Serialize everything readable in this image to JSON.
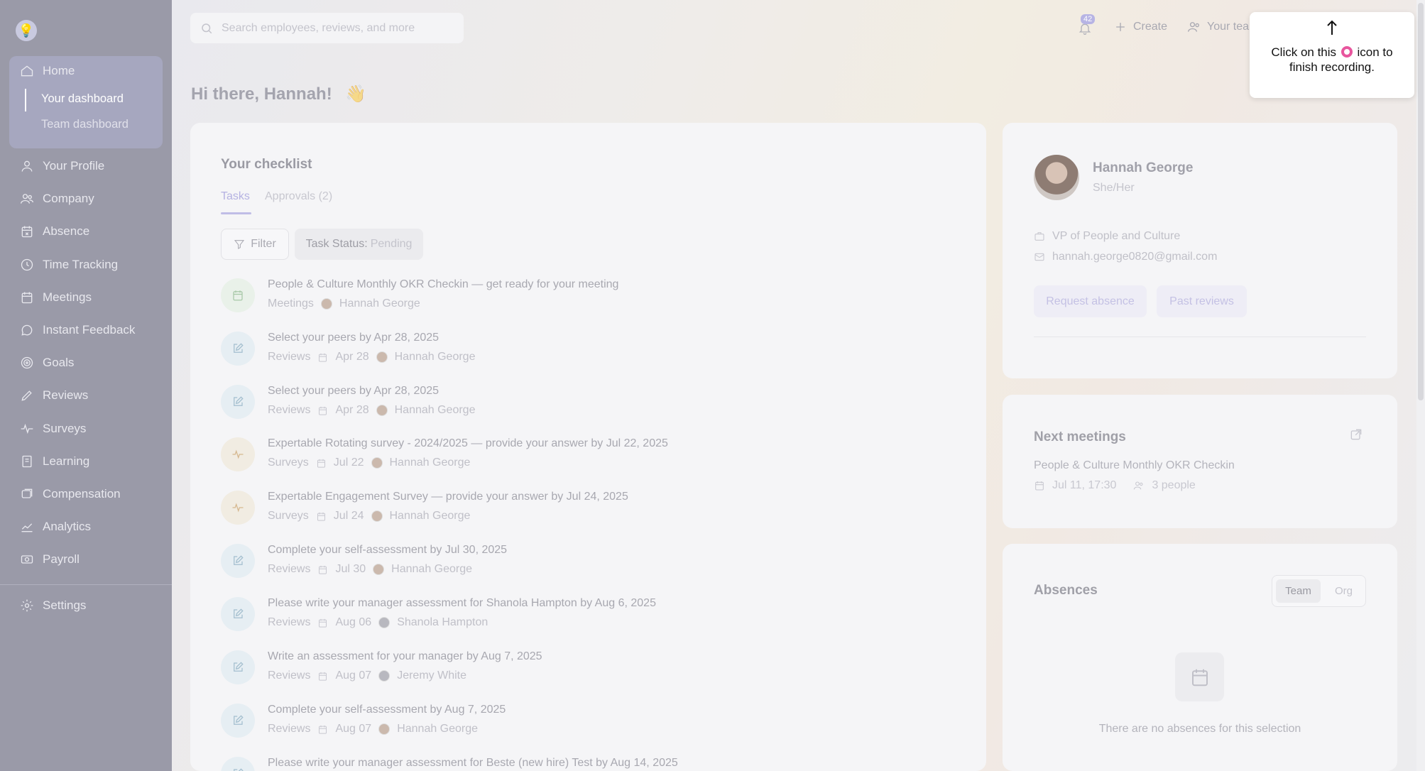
{
  "sidebar": {
    "home_group": {
      "label": "Home",
      "sub_items": [
        "Your dashboard",
        "Team dashboard"
      ]
    },
    "items": [
      {
        "label": "Your Profile",
        "icon": "user-icon"
      },
      {
        "label": "Company",
        "icon": "users-icon"
      },
      {
        "label": "Absence",
        "icon": "calendar-x-icon"
      },
      {
        "label": "Time Tracking",
        "icon": "clock-icon"
      },
      {
        "label": "Meetings",
        "icon": "calendar-icon"
      },
      {
        "label": "Instant Feedback",
        "icon": "chat-icon"
      },
      {
        "label": "Goals",
        "icon": "target-icon"
      },
      {
        "label": "Reviews",
        "icon": "pencil-icon"
      },
      {
        "label": "Surveys",
        "icon": "pulse-icon"
      },
      {
        "label": "Learning",
        "icon": "book-icon"
      },
      {
        "label": "Compensation",
        "icon": "coins-icon"
      },
      {
        "label": "Analytics",
        "icon": "chart-icon"
      },
      {
        "label": "Payroll",
        "icon": "money-icon"
      }
    ],
    "settings_label": "Settings"
  },
  "topbar": {
    "search_placeholder": "Search employees, reviews, and more",
    "notification_count": "42",
    "create_label": "Create",
    "team_label": "Your team"
  },
  "greeting": {
    "text": "Hi there, Hannah!",
    "emoji": "👋"
  },
  "checklist": {
    "title": "Your checklist",
    "tabs": [
      "Tasks",
      "Approvals (2)"
    ],
    "filter_label": "Filter",
    "status_label": "Task Status:",
    "status_value": "Pending",
    "tasks": [
      {
        "title": "People & Culture Monthly OKR Checkin — get ready for your meeting",
        "type": "Meetings",
        "date": "",
        "person": "Hannah George",
        "icon": "calendar-icon"
      },
      {
        "title": "Select your peers by Apr 28, 2025",
        "type": "Reviews",
        "date": "Apr 28",
        "person": "Hannah George",
        "icon": "edit-icon"
      },
      {
        "title": "Select your peers by Apr 28, 2025",
        "type": "Reviews",
        "date": "Apr 28",
        "person": "Hannah George",
        "icon": "edit-icon"
      },
      {
        "title": "Expertable Rotating survey - 2024/2025 — provide your answer by Jul 22, 2025",
        "type": "Surveys",
        "date": "Jul 22",
        "person": "Hannah George",
        "icon": "pulse-icon"
      },
      {
        "title": "Expertable Engagement Survey — provide your answer by Jul 24, 2025",
        "type": "Surveys",
        "date": "Jul 24",
        "person": "Hannah George",
        "icon": "pulse-icon"
      },
      {
        "title": "Complete your self-assessment by Jul 30, 2025",
        "type": "Reviews",
        "date": "Jul 30",
        "person": "Hannah George",
        "icon": "edit-icon"
      },
      {
        "title": "Please write your manager assessment for Shanola Hampton by Aug 6, 2025",
        "type": "Reviews",
        "date": "Aug 06",
        "person": "Shanola Hampton",
        "icon": "edit-icon"
      },
      {
        "title": "Write an assessment for your manager by Aug 7, 2025",
        "type": "Reviews",
        "date": "Aug 07",
        "person": "Jeremy White",
        "icon": "edit-icon"
      },
      {
        "title": "Complete your self-assessment by Aug 7, 2025",
        "type": "Reviews",
        "date": "Aug 07",
        "person": "Hannah George",
        "icon": "edit-icon"
      },
      {
        "title": "Please write your manager assessment for Beste (new hire) Test by Aug 14, 2025",
        "type": "",
        "date": "",
        "person": "",
        "icon": "edit-icon"
      }
    ]
  },
  "profile": {
    "name": "Hannah George",
    "pronouns": "She/Her",
    "title": "VP of People and Culture",
    "email": "hannah.george0820@gmail.com",
    "actions": [
      "Request absence",
      "Past reviews"
    ]
  },
  "meetings": {
    "title": "Next meetings",
    "item_title": "People & Culture Monthly OKR Checkin",
    "item_date": "Jul 11, 17:30",
    "item_people": "3 people"
  },
  "absences": {
    "title": "Absences",
    "toggle": [
      "Team",
      "Org"
    ],
    "empty_text": "There are no absences for this selection"
  },
  "tooltip": {
    "line_before": "Click on this",
    "line_after": "icon to finish recording."
  },
  "colors": {
    "accent": "#b5b2e2",
    "record": "#e8569e",
    "sidebar": "#9a9aa8"
  }
}
